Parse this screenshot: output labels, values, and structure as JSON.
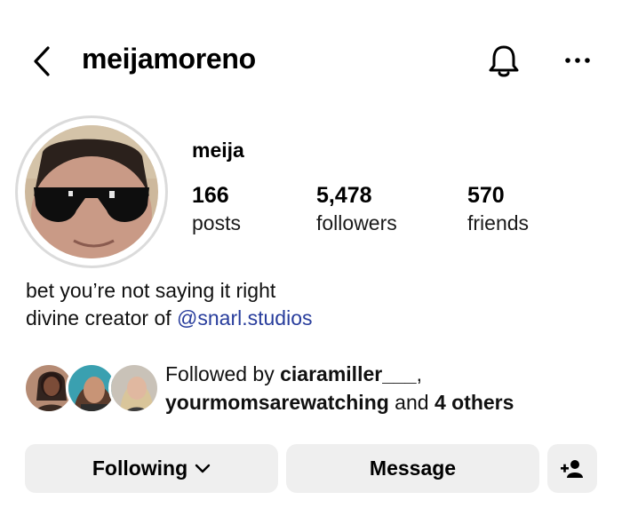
{
  "header": {
    "username": "meijamoreno",
    "back_icon": "chevron-left-icon",
    "notifications_icon": "bell-icon",
    "more_icon": "more-horizontal-icon"
  },
  "profile": {
    "display_name": "meija",
    "stats": [
      {
        "value": "166",
        "label": "posts"
      },
      {
        "value": "5,478",
        "label": "followers"
      },
      {
        "value": "570",
        "label": "friends"
      }
    ],
    "bio_line1": "bet you’re not saying it right",
    "bio_line2_prefix": "divine creator of ",
    "bio_mention": "@snarl.studios"
  },
  "followed_by": {
    "prefix": "Followed by ",
    "user1": "ciaramiller___",
    "separator": ",",
    "user2": "yourmomsarewatching",
    "and_text": " and ",
    "others": "4 others"
  },
  "actions": {
    "following_label": "Following",
    "message_label": "Message",
    "add_user_icon": "add-person-icon"
  },
  "colors": {
    "mention": "#283d9c",
    "button_bg": "#efefef",
    "avatar_ring": "#dbdbdb"
  }
}
